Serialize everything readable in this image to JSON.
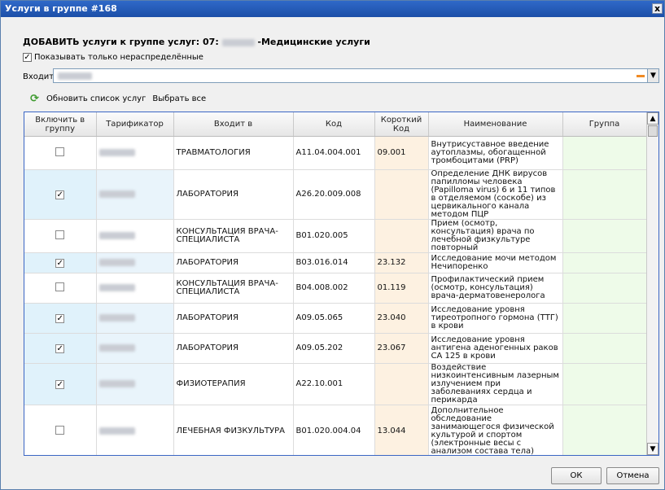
{
  "window": {
    "title": "Услуги в группе #168",
    "close_label": "x"
  },
  "heading": {
    "prefix": "ДОБАВИТЬ услуги к группе услуг: 07:",
    "suffix": "-Медицинские услуги"
  },
  "filter": {
    "checkbox_checked": true,
    "label": "Показывать только нераспределённые"
  },
  "entry": {
    "label": "Входит в"
  },
  "toolbar": {
    "refresh_label": "Обновить список услуг",
    "select_all_label": "Выбрать все"
  },
  "grid": {
    "columns": [
      "Включить в группу",
      "Тарификатор",
      "Входит в",
      "Код",
      "Короткий Код",
      "Наименование",
      "Группа"
    ],
    "rows": [
      {
        "checked": false,
        "part_of": "ТРАВМАТОЛОГИЯ",
        "code": "A11.04.004.001",
        "short_code": "09.001",
        "name": "Внутрисуставное введение аутоплазмы, обогащенной тромбоцитами (PRP)",
        "group": ""
      },
      {
        "checked": true,
        "part_of": "ЛАБОРАТОРИЯ",
        "code": "A26.20.009.008",
        "short_code": "",
        "name": "Определение ДНК вирусов папилломы человека (Papilloma virus) 6 и 11 типов в отделяемом (соскобе) из цервикального канала методом ПЦР",
        "group": ""
      },
      {
        "checked": false,
        "part_of": "КОНСУЛЬТАЦИЯ ВРАЧА-СПЕЦИАЛИСТА",
        "code": "B01.020.005",
        "short_code": "",
        "name": "Прием (осмотр, консультация) врача по лечебной физкультуре повторный",
        "group": ""
      },
      {
        "checked": true,
        "part_of": "ЛАБОРАТОРИЯ",
        "code": "B03.016.014",
        "short_code": "23.132",
        "name": "Исследование мочи методом Нечипоренко",
        "group": ""
      },
      {
        "checked": false,
        "part_of": "КОНСУЛЬТАЦИЯ ВРАЧА-СПЕЦИАЛИСТА",
        "code": "B04.008.002",
        "short_code": "01.119",
        "name": "Профилактический прием (осмотр, консультация) врача-дерматовенеролога",
        "group": ""
      },
      {
        "checked": true,
        "part_of": "ЛАБОРАТОРИЯ",
        "code": "A09.05.065",
        "short_code": "23.040",
        "name": "Исследование уровня тиреотропного гормона (ТТГ) в крови",
        "group": ""
      },
      {
        "checked": true,
        "part_of": "ЛАБОРАТОРИЯ",
        "code": "A09.05.202",
        "short_code": "23.067",
        "name": "Исследование уровня антигена аденогенных раков CA 125 в крови",
        "group": ""
      },
      {
        "checked": true,
        "part_of": "ФИЗИОТЕРАПИЯ",
        "code": "A22.10.001",
        "short_code": "",
        "name": "Воздействие низкоинтенсивным лазерным излучением при заболеваниях сердца и перикарда",
        "group": ""
      },
      {
        "checked": false,
        "part_of": "ЛЕЧЕБНАЯ ФИЗКУЛЬТУРА",
        "code": "B01.020.004.04",
        "short_code": "13.044",
        "name": "Дополнительное обследование занимающегося физической культурой и спортом (электронные весы с анализом состава тела)",
        "group": ""
      }
    ]
  },
  "buttons": {
    "ok_label": "ОК",
    "cancel_label": "Отмена"
  }
}
